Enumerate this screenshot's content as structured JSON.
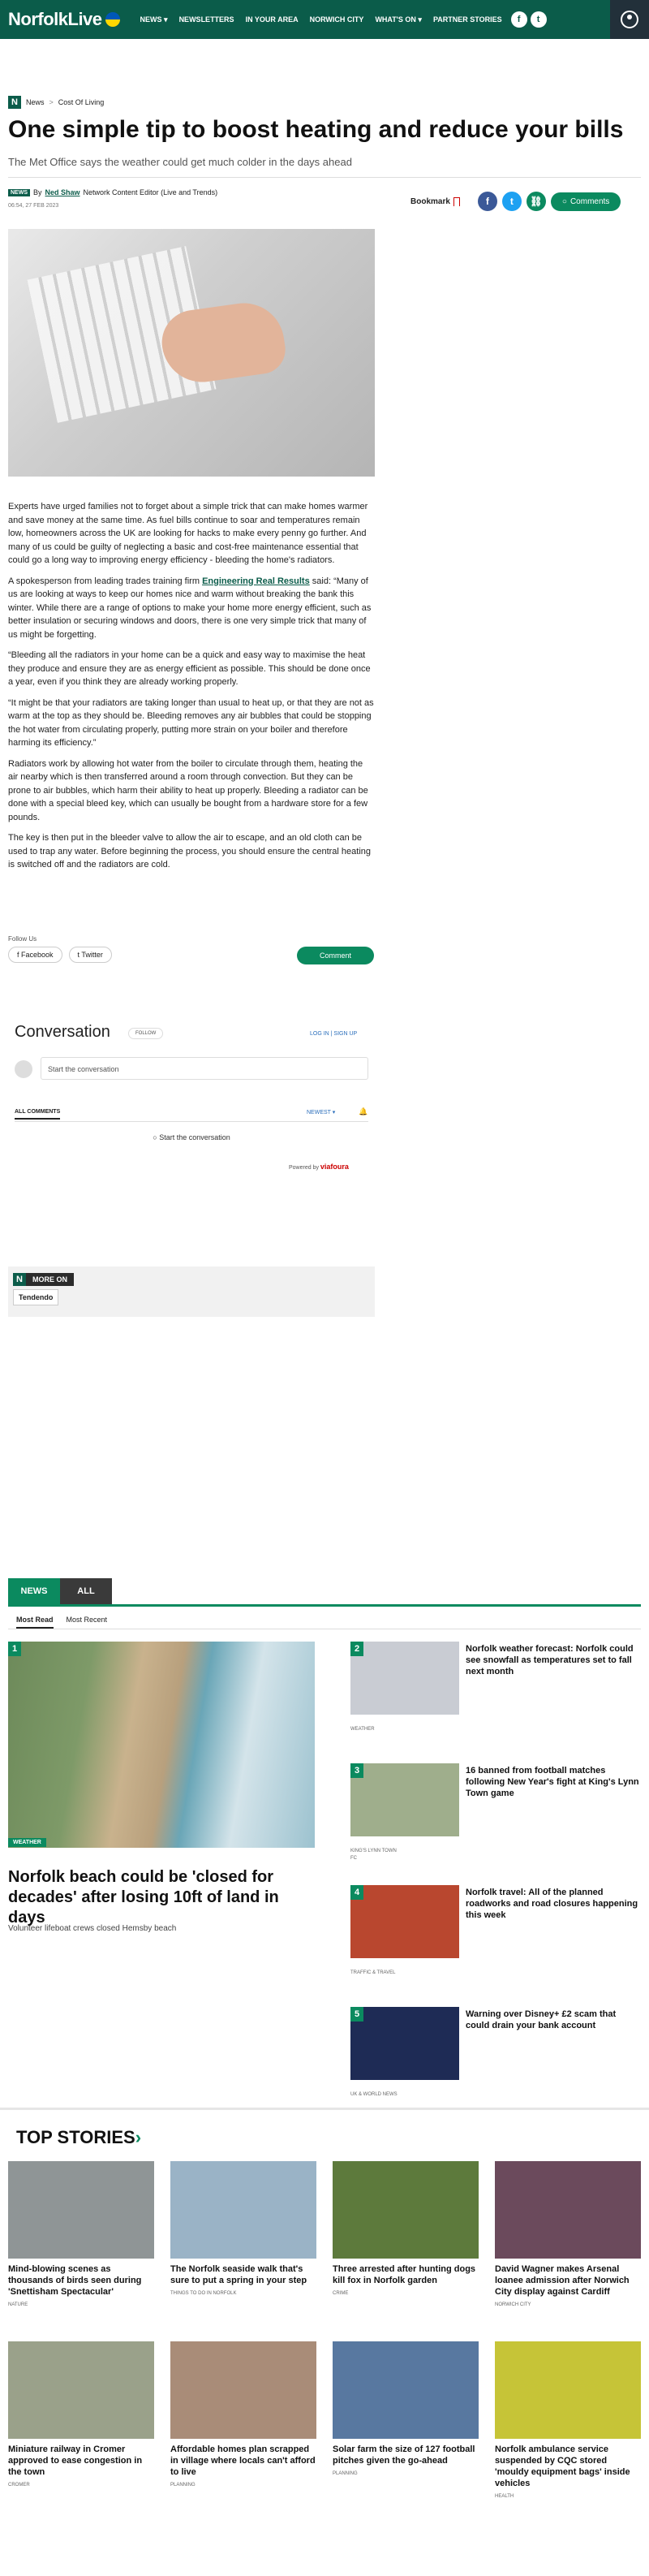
{
  "site": {
    "logo": "NorfolkLive",
    "nav": [
      "NEWS ▾",
      "NEWSLETTERS",
      "IN YOUR AREA",
      "NORWICH CITY",
      "WHAT'S ON ▾",
      "PARTNER STORIES"
    ]
  },
  "breadcrumb": {
    "badge": "N",
    "items": [
      "News",
      "Cost Of Living"
    ],
    "separator": ">"
  },
  "article": {
    "title": "One simple tip to boost heating and reduce your bills",
    "standfirst": "The Met Office says the weather could get much colder in the days ahead",
    "byline_badge": "NEWS",
    "by": "By",
    "author": "Ned Shaw",
    "author_role": "Network Content Editor (Live and Trends)",
    "date": "06:54, 27 FEB 2023",
    "bookmark": "Bookmark",
    "comments_label": "Comments",
    "paragraphs": [
      "Experts have urged families not to forget about a simple trick that can make homes warmer and save money at the same time. As fuel bills continue to soar and temperatures remain low, homeowners across the UK are looking for hacks to make every penny go further. And many of us could be guilty of neglecting a basic and cost-free maintenance essential that could go a long way to improving energy efficiency - bleeding the home's radiators.",
      "“Bleeding all the radiators in your home can be a quick and easy way to maximise the heat they produce and ensure they are as energy efficient as possible. This should be done once a year, even if you think they are already working properly.",
      "“It might be that your radiators are taking longer than usual to heat up, or that they are not as warm at the top as they should be. Bleeding removes any air bubbles that could be stopping the hot water from circulating properly, putting more strain on your boiler and therefore harming its efficiency.”",
      "Radiators work by allowing hot water from the boiler to circulate through them, heating the air nearby which is then transferred around a room through convection. But they can be prone to air bubbles, which harm their ability to heat up properly. Bleeding a radiator can be done with a special bleed key, which can usually be bought from a hardware store for a few pounds.",
      "The key is then put in the bleeder valve to allow the air to escape, and an old cloth can be used to trap any water. Before beginning the process, you should ensure the central heating is switched off and the radiators are cold."
    ],
    "p2_before": "A spokesperson from leading trades training firm ",
    "p2_link": "Engineering Real Results",
    "p2_after": " said: “Many of us are looking at ways to keep our homes nice and warm without breaking the bank this winter. While there are a range of options to make your home more energy efficient, such as better insulation or securing windows and doors, there is one very simple trick that many of us might be forgetting.",
    "follow_us": "Follow Us",
    "follow_facebook": "Facebook",
    "follow_twitter": "Twitter",
    "comment_button": "Comment"
  },
  "conversation": {
    "title": "Conversation",
    "follow": "FOLLOW",
    "login": "LOG IN  |  SIGN UP",
    "placeholder": "Start the conversation",
    "all_comments": "ALL COMMENTS",
    "sort": "NEWEST ▾",
    "start": "Start the conversation",
    "powered": "Powered by",
    "powered_brand": "viafoura"
  },
  "more_on": {
    "label": "MORE ON",
    "tag": "Tendendo"
  },
  "most_read": {
    "tabs": [
      "NEWS",
      "ALL"
    ],
    "subtabs": [
      "Most Read",
      "Most Recent"
    ],
    "lead": {
      "rank": "1",
      "category": "WEATHER",
      "title": "Norfolk beach could be 'closed for decades' after losing 10ft of land in days",
      "subtitle": "Volunteer lifeboat crews closed Hemsby beach"
    },
    "items": [
      {
        "rank": "2",
        "title": "Norfolk weather forecast: Norfolk could see snowfall as temperatures set to fall next month",
        "category": "WEATHER",
        "color": "#c9ccd3"
      },
      {
        "rank": "3",
        "title": "16 banned from football matches following New Year's fight at King's Lynn Town game",
        "category": "KING'S LYNN TOWN FC",
        "color": "#9fae8c"
      },
      {
        "rank": "4",
        "title": "Norfolk travel: All of the planned roadworks and road closures happening this week",
        "category": "TRAFFIC & TRAVEL",
        "color": "#b9472f"
      },
      {
        "rank": "5",
        "title": "Warning over Disney+ £2 scam that could drain your bank account",
        "category": "UK & WORLD NEWS",
        "color": "#1e2b55"
      }
    ]
  },
  "top_stories": {
    "heading": "TOP STORIES",
    "chevron": "›",
    "cards": [
      {
        "title": "Mind-blowing scenes as thousands of birds seen during 'Snettisham Spectacular'",
        "category": "NATURE",
        "color": "#8f9596"
      },
      {
        "title": "The Norfolk seaside walk that's sure to put a spring in your step",
        "category": "THINGS TO DO IN NORFOLK",
        "color": "#9ab3c6"
      },
      {
        "title": "Three arrested after hunting dogs kill fox in Norfolk garden",
        "category": "CRIME",
        "color": "#5d7a3c"
      },
      {
        "title": "David Wagner makes Arsenal loanee admission after Norwich City display against Cardiff",
        "category": "NORWICH CITY",
        "color": "#6b4a5c"
      },
      {
        "title": "Miniature railway in Cromer approved to ease congestion in the town",
        "category": "CROMER",
        "color": "#9aa18a"
      },
      {
        "title": "Affordable homes plan scrapped in village where locals can't afford to live",
        "category": "PLANNING",
        "color": "#a98c78"
      },
      {
        "title": "Solar farm the size of 127 football pitches given the go-ahead",
        "category": "PLANNING",
        "color": "#5878a0"
      },
      {
        "title": "Norfolk ambulance service suspended by CQC stored 'mouldy equipment bags' inside vehicles",
        "category": "HEALTH",
        "color": "#c6c437"
      }
    ]
  },
  "colors": {
    "brand": "#0b5c4a",
    "accent": "#0b8a5f",
    "facebook": "#3b5998",
    "twitter": "#1da1f2"
  }
}
